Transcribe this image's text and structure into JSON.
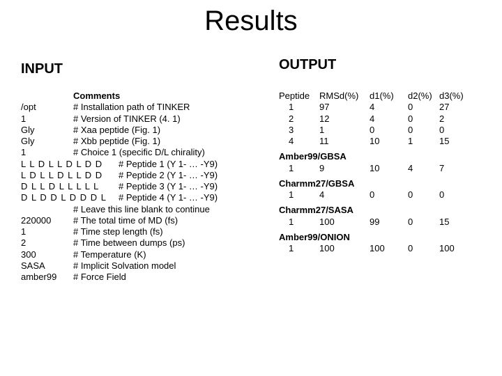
{
  "title": "Results",
  "input": {
    "header": "INPUT",
    "comments_label": "Comments",
    "rows": [
      {
        "key": "/opt",
        "comment": "# Installation path of TINKER"
      },
      {
        "key": "1",
        "comment": "# Version of TINKER (4. 1)"
      },
      {
        "key": "Gly",
        "comment": "# Xaa peptide (Fig. 1)"
      },
      {
        "key": "Gly",
        "comment": "# Xbb peptide (Fig. 1)"
      },
      {
        "key": "1",
        "comment": "# Choice 1 (specific D/L chirality)"
      }
    ],
    "seq_rows": [
      {
        "seq": "L L D L L D L D D",
        "comment": "# Peptide 1 (Y 1- … -Y9)"
      },
      {
        "seq": "L D L L D L L D D",
        "comment": "# Peptide 2 (Y 1- … -Y9)"
      },
      {
        "seq": "D L L D L L L L L",
        "comment": "# Peptide 3 (Y 1- … -Y9)"
      },
      {
        "seq": "D L D D L D D D L",
        "comment": "# Peptide 4 (Y 1- … -Y9)"
      }
    ],
    "blank_comment": "# Leave this line blank to continue",
    "rows2": [
      {
        "key": "220000",
        "comment": "# The total time of MD (fs)"
      },
      {
        "key": "1",
        "comment": "# Time step length (fs)"
      },
      {
        "key": "2",
        "comment": "# Time between dumps (ps)"
      },
      {
        "key": "300",
        "comment": "# Temperature (K)"
      },
      {
        "key": "SASA",
        "comment": "# Implicit Solvation model"
      },
      {
        "key": "amber99",
        "comment": "# Force Field"
      }
    ]
  },
  "output": {
    "header": "OUTPUT",
    "columns": {
      "peptide": "Peptide",
      "rmsd": "RMSd(%)",
      "d1": "d1(%)",
      "d2": "d2(%)",
      "d3": "d3(%)"
    },
    "main": [
      {
        "pep": "1",
        "rmsd": "97",
        "d1": "4",
        "d2": "0",
        "d3": "27"
      },
      {
        "pep": "2",
        "rmsd": "12",
        "d1": "4",
        "d2": "0",
        "d3": "2"
      },
      {
        "pep": "3",
        "rmsd": "1",
        "d1": "0",
        "d2": "0",
        "d3": "0"
      },
      {
        "pep": "4",
        "rmsd": "11",
        "d1": "10",
        "d2": "1",
        "d3": "15"
      }
    ],
    "groups": [
      {
        "name": "Amber99/GBSA",
        "pep": "1",
        "rmsd": "9",
        "d1": "10",
        "d2": "4",
        "d3": "7"
      },
      {
        "name": "Charmm27/GBSA",
        "pep": "1",
        "rmsd": "4",
        "d1": "0",
        "d2": "0",
        "d3": "0"
      },
      {
        "name": "Charmm27/SASA",
        "pep": "1",
        "rmsd": "100",
        "d1": "99",
        "d2": "0",
        "d3": "15"
      },
      {
        "name": "Amber99/ONION",
        "pep": "1",
        "rmsd": "100",
        "d1": "100",
        "d2": "0",
        "d3": "100"
      }
    ]
  }
}
